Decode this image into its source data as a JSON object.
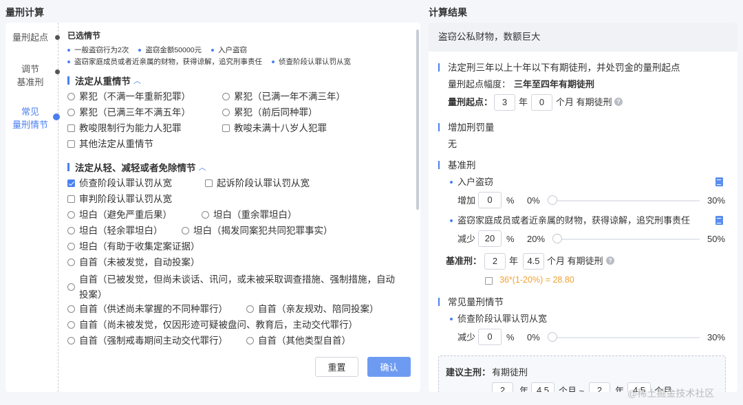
{
  "left": {
    "title": "量刑计算",
    "steps": [
      "量刑起点",
      "调节\n基准刑",
      "常见\n量刑情节"
    ],
    "selected_title": "已选情节",
    "selected_tags": [
      "一般盗窃行为2次",
      "盗窃金额50000元",
      "入户盗窃",
      "盗窃家庭成员或者近亲属的财物，获得谅解，追究刑事责任",
      "侦查阶段认罪认罚从宽"
    ],
    "group1_title": "法定从重情节",
    "group1_opts": [
      "累犯（不满一年重新犯罪）",
      "累犯（已满一年不满三年）",
      "累犯（已满三年不满五年）",
      "累犯（前后同种罪）",
      "教唆限制行为能力人犯罪",
      "教唆未满十八岁人犯罪",
      "其他法定从重情节"
    ],
    "group2_title": "法定从轻、减轻或者免除情节",
    "group2_opts": [
      "侦查阶段认罪认罚从宽",
      "起诉阶段认罪认罚从宽",
      "审判阶段认罪认罚从宽",
      "坦白（避免严重后果）",
      "坦白（重余罪坦白）",
      "坦白（轻余罪坦白）",
      "坦白（揭发同案犯共同犯罪事实）",
      "坦白（有助于收集定案证据）",
      "自首（未被发觉，自动投案）",
      "自首（已被发觉，但尚未谈话、讯问，或未被采取调查措施、强制措施，自动投案）",
      "自首（供述尚未掌握的不同种罪行）",
      "自首（亲友规劝、陪同投案）",
      "自首（尚未被发觉，仅因形迹可疑被盘问、教育后，主动交代罪行）",
      "自首（强制戒毒期间主动交代罪行）",
      "自首（其他类型自首）"
    ],
    "reset_label": "重置",
    "confirm_label": "确认"
  },
  "right": {
    "title": "计算结果",
    "header": "盗窃公私财物，数额巨大",
    "s1_title": "法定刑三年以上十年以下有期徒刑，并处罚金的量刑起点",
    "s1_range_label": "量刑起点幅度：",
    "s1_range_value": "三年至四年有期徒刑",
    "s1_start_label": "量刑起点：",
    "s1_years": "3",
    "unit_year": "年",
    "s1_months": "0",
    "s1_month_suffix": "个月 有期徒刑",
    "s2_title": "增加刑罚量",
    "s2_value": "无",
    "s3_title": "基准刑",
    "item1_label": "入户盗窃",
    "item1_op": "增加",
    "item1_val": "0",
    "pct": "%",
    "item1_min": "0%",
    "item1_max": "30%",
    "item1_level": 0,
    "item2_label": "盗窃家庭成员或者近亲属的财物，获得谅解，追究刑事责任",
    "item2_op": "减少",
    "item2_val": "20",
    "item2_min": "20%",
    "item2_max": "50%",
    "item2_level": 0,
    "base_label": "基准刑：",
    "base_years": "2",
    "base_months": "4.5",
    "formula": "36*(1-20%) = 28.80",
    "s4_title": "常见量刑情节",
    "item3_label": "侦查阶段认罪认罚从宽",
    "item3_op": "减少",
    "item3_val": "0",
    "item3_min": "0%",
    "item3_max": "30%",
    "item3_level": 0,
    "suggest_label": "建议主刑：",
    "suggest_value": "有期徒刑",
    "sug_years1": "2",
    "sug_months1": "4.5",
    "sug_month_sep": "个月 ~",
    "sug_years2": "2",
    "sug_months2": "4.5",
    "sug_month_end": "个月"
  },
  "watermark": "@稀土掘金技术社区"
}
